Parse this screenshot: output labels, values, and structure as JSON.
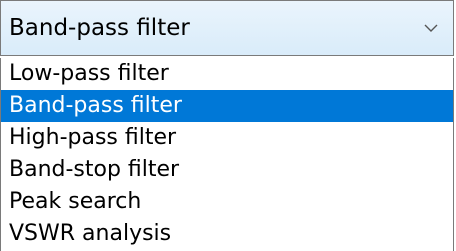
{
  "combo": {
    "selected_label": "Band-pass filter",
    "arrow_icon": "chevron-down-icon"
  },
  "options": [
    {
      "label": "Low-pass filter",
      "selected": false
    },
    {
      "label": "Band-pass filter",
      "selected": true
    },
    {
      "label": "High-pass filter",
      "selected": false
    },
    {
      "label": "Band-stop filter",
      "selected": false
    },
    {
      "label": "Peak search",
      "selected": false
    },
    {
      "label": "VSWR analysis",
      "selected": false
    }
  ],
  "colors": {
    "selection_background": "#0078d7",
    "selection_text": "#ffffff",
    "combo_background": "#d9ecfa",
    "border": "#7a7a7a"
  }
}
